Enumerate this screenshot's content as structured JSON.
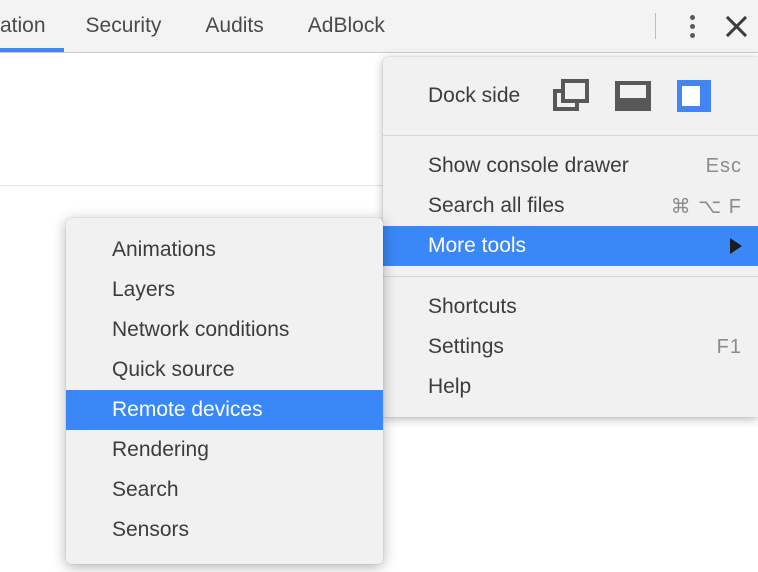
{
  "toolbar": {
    "tabs": [
      {
        "label": "ation",
        "clipped": true,
        "active": true
      },
      {
        "label": "Security",
        "clipped": false,
        "active": false
      },
      {
        "label": "Audits",
        "clipped": false,
        "active": false
      },
      {
        "label": "AdBlock",
        "clipped": false,
        "active": false
      }
    ],
    "more_options_icon": "kebab-menu-icon",
    "close_icon": "close-icon"
  },
  "main_menu": {
    "dock_side": {
      "label": "Dock side",
      "options": [
        {
          "name": "undock-into-separate-window-icon",
          "selected": false
        },
        {
          "name": "dock-to-bottom-icon",
          "selected": false
        },
        {
          "name": "dock-to-right-icon",
          "selected": true
        }
      ]
    },
    "group_a": [
      {
        "label": "Show console drawer",
        "accel": "Esc",
        "selected": false,
        "submenu": false
      },
      {
        "label": "Search all files",
        "accel": "⌘ ⌥ F",
        "selected": false,
        "submenu": false
      },
      {
        "label": "More tools",
        "accel": "",
        "selected": true,
        "submenu": true
      }
    ],
    "group_b": [
      {
        "label": "Shortcuts",
        "accel": "",
        "selected": false,
        "submenu": false
      },
      {
        "label": "Settings",
        "accel": "F1",
        "selected": false,
        "submenu": false
      },
      {
        "label": "Help",
        "accel": "",
        "selected": false,
        "submenu": false
      }
    ]
  },
  "sub_menu": {
    "items": [
      {
        "label": "Animations",
        "selected": false
      },
      {
        "label": "Layers",
        "selected": false
      },
      {
        "label": "Network conditions",
        "selected": false
      },
      {
        "label": "Quick source",
        "selected": false
      },
      {
        "label": "Remote devices",
        "selected": true
      },
      {
        "label": "Rendering",
        "selected": false
      },
      {
        "label": "Search",
        "selected": false
      },
      {
        "label": "Sensors",
        "selected": false
      }
    ]
  },
  "colors": {
    "accent_blue": "#4285f4",
    "selection_blue": "#3a87f7",
    "menu_bg": "#f1f1f1",
    "toolbar_bg": "#f3f3f3",
    "text": "#3c3c3c",
    "accel_text": "#8c8c8c"
  }
}
